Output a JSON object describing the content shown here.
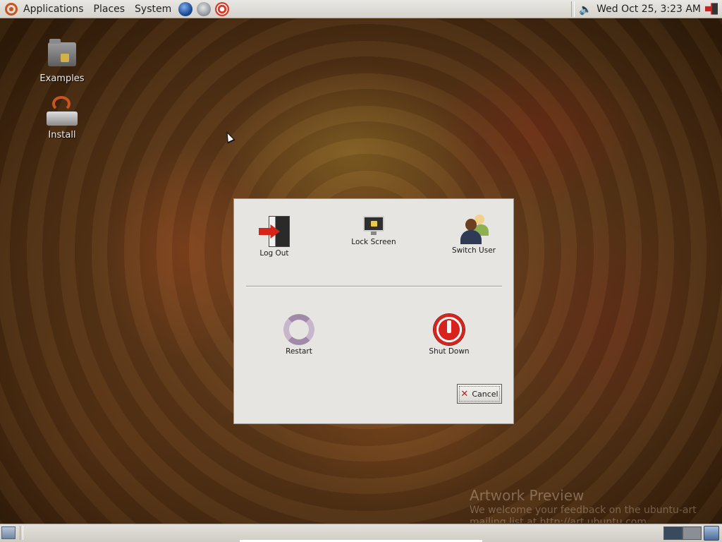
{
  "top_panel": {
    "menus": [
      "Applications",
      "Places",
      "System"
    ],
    "launchers": [
      "web-browser",
      "mail-client",
      "help"
    ],
    "clock": "Wed Oct 25,  3:23 AM"
  },
  "desktop": {
    "icons": [
      {
        "label": "Examples",
        "icon": "folder-icon"
      },
      {
        "label": "Install",
        "icon": "installer-icon"
      }
    ],
    "artwork_preview": {
      "title": "Artwork Preview",
      "text": "We welcome your feedback on the ubuntu-art mailing list at http://art.ubuntu.com"
    }
  },
  "logout_dialog": {
    "actions": [
      {
        "label": "Log Out",
        "icon": "log-out-icon"
      },
      {
        "label": "Lock Screen",
        "icon": "lock-screen-icon"
      },
      {
        "label": "Switch User",
        "icon": "switch-user-icon"
      },
      {
        "label": "Restart",
        "icon": "restart-icon"
      },
      {
        "label": "Shut Down",
        "icon": "shut-down-icon"
      }
    ],
    "cancel_label": "Cancel"
  },
  "bottom_panel": {
    "workspaces": 2
  },
  "colors": {
    "ubuntu_orange": "#c8551f",
    "shutdown_red": "#d8231c",
    "panel_grey": "#dcd9d3",
    "dialog_bg": "#e7e5e1"
  }
}
